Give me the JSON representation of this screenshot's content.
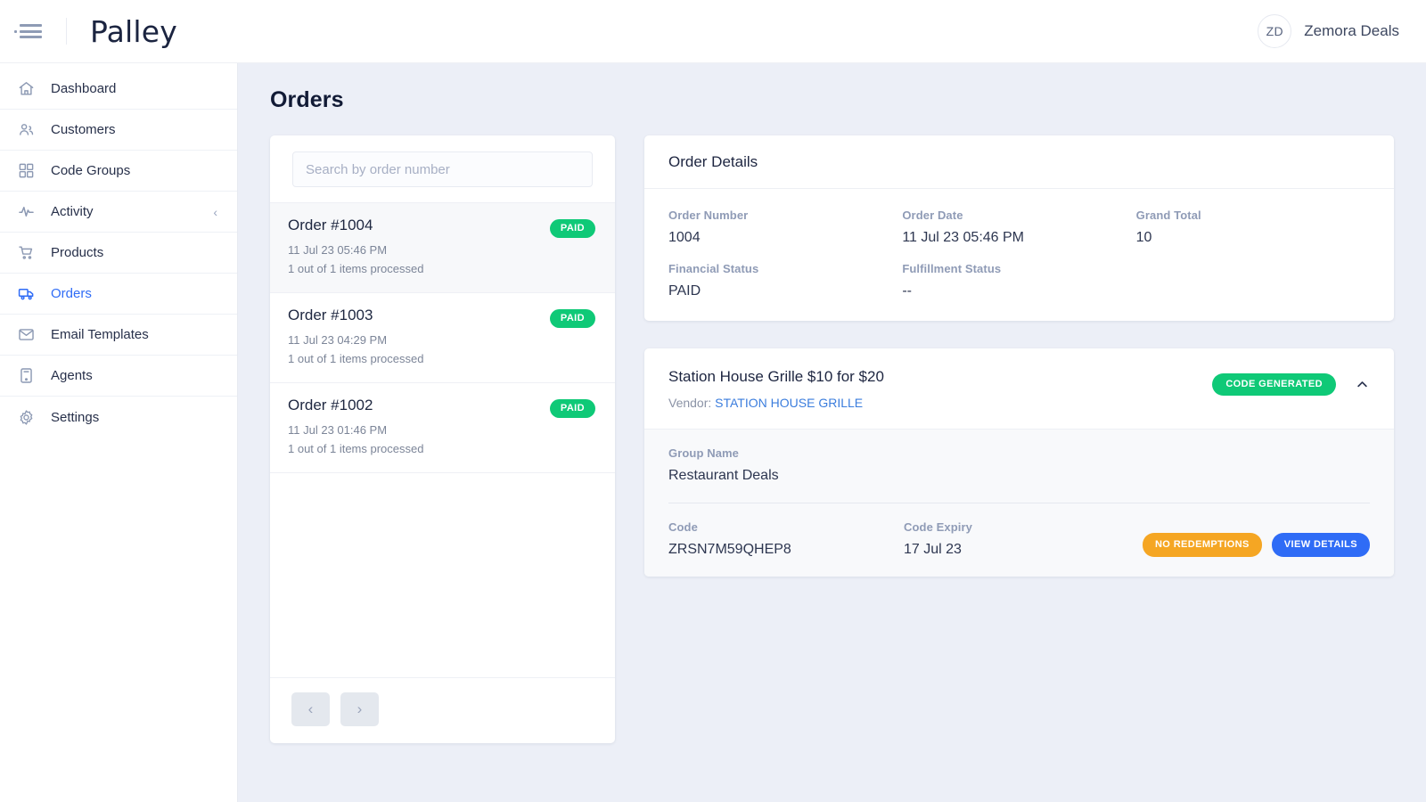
{
  "topbar": {
    "menu_icon": "hamburger-icon",
    "brand": "Palley",
    "user": {
      "initials": "ZD",
      "name": "Zemora Deals"
    }
  },
  "sidebar": {
    "items": [
      {
        "label": "Dashboard",
        "icon": "home-icon",
        "active": false,
        "chevron": ""
      },
      {
        "label": "Customers",
        "icon": "users-icon",
        "active": false,
        "chevron": ""
      },
      {
        "label": "Code Groups",
        "icon": "grid-icon",
        "active": false,
        "chevron": ""
      },
      {
        "label": "Activity",
        "icon": "pulse-icon",
        "active": false,
        "chevron": "‹"
      },
      {
        "label": "Products",
        "icon": "cart-icon",
        "active": false,
        "chevron": ""
      },
      {
        "label": "Orders",
        "icon": "truck-icon",
        "active": true,
        "chevron": ""
      },
      {
        "label": "Email Templates",
        "icon": "envelope-icon",
        "active": false,
        "chevron": ""
      },
      {
        "label": "Agents",
        "icon": "tablet-icon",
        "active": false,
        "chevron": ""
      },
      {
        "label": "Settings",
        "icon": "gear-icon",
        "active": false,
        "chevron": ""
      }
    ]
  },
  "page": {
    "title": "Orders"
  },
  "orders_panel": {
    "search": {
      "placeholder": "Search by order number",
      "value": ""
    },
    "orders": [
      {
        "title": "Order #1004",
        "date": "11 Jul 23 05:46 PM",
        "progress": "1 out of 1 items processed",
        "status": "PAID",
        "selected": true
      },
      {
        "title": "Order #1003",
        "date": "11 Jul 23 04:29 PM",
        "progress": "1 out of 1 items processed",
        "status": "PAID",
        "selected": false
      },
      {
        "title": "Order #1002",
        "date": "11 Jul 23 01:46 PM",
        "progress": "1 out of 1 items processed",
        "status": "PAID",
        "selected": false
      }
    ],
    "pagination": {
      "prev": "‹",
      "next": "›"
    }
  },
  "order_details": {
    "heading": "Order Details",
    "fields": [
      {
        "label": "Order Number",
        "value": "1004"
      },
      {
        "label": "Order Date",
        "value": "11 Jul 23 05:46 PM"
      },
      {
        "label": "Grand Total",
        "value": "10"
      },
      {
        "label": "Financial Status",
        "value": "PAID"
      },
      {
        "label": "Fulfillment Status",
        "value": "--"
      }
    ]
  },
  "product_card": {
    "name": "Station House Grille $10 for $20",
    "vendor_label": "Vendor:",
    "vendor_name": "STATION HOUSE GRILLE",
    "status_badge": "CODE GENERATED",
    "collapse_icon": "chevron-up-icon",
    "group": {
      "label": "Group Name",
      "value": "Restaurant Deals"
    },
    "code": {
      "label": "Code",
      "value": "ZRSN7M59QHEP8"
    },
    "expiry": {
      "label": "Code Expiry",
      "value": "17 Jul 23"
    },
    "actions": {
      "redemptions": "NO REDEMPTIONS",
      "view_details": "VIEW DETAILS"
    }
  },
  "colors": {
    "accent_blue": "#2f6cf6",
    "green": "#0fc977",
    "orange": "#f5a623",
    "link_blue": "#3b7ddd",
    "bg": "#eceff7"
  }
}
